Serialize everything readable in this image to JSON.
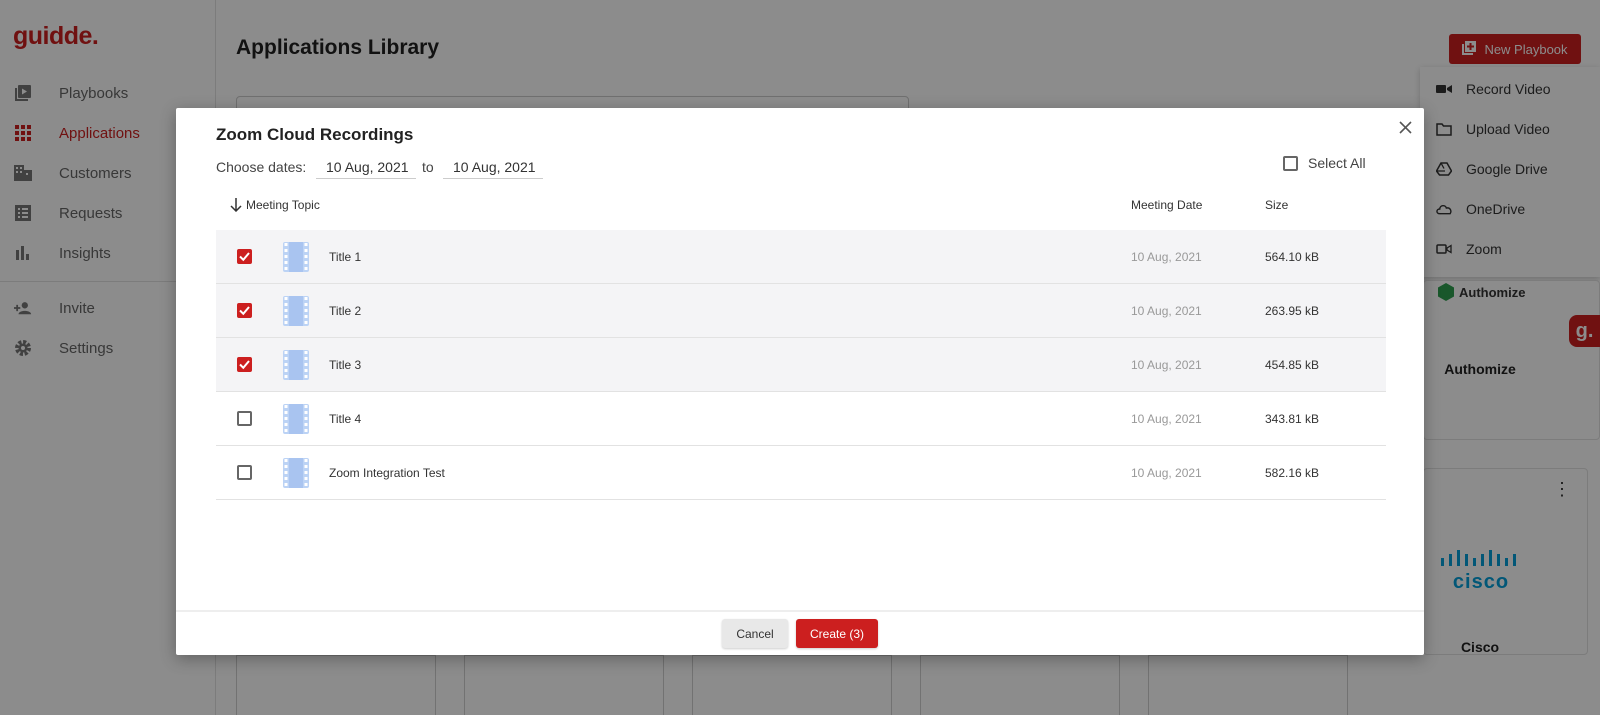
{
  "app": {
    "logo": "guidde.",
    "brand_color": "#cc1f1f"
  },
  "sidebar": {
    "items": [
      {
        "label": "Playbooks",
        "icon": "playbooks-icon"
      },
      {
        "label": "Applications",
        "icon": "apps-grid-icon"
      },
      {
        "label": "Customers",
        "icon": "building-icon"
      },
      {
        "label": "Requests",
        "icon": "list-icon"
      },
      {
        "label": "Insights",
        "icon": "bar-chart-icon"
      },
      {
        "label": "Invite",
        "icon": "add-user-icon"
      },
      {
        "label": "Settings",
        "icon": "gear-icon"
      }
    ]
  },
  "header": {
    "title": "Applications Library",
    "new_playbook_label": "New Playbook"
  },
  "new_menu": {
    "items": [
      {
        "label": "Record Video",
        "icon": "video-camera-icon"
      },
      {
        "label": "Upload Video",
        "icon": "folder-icon"
      },
      {
        "label": "Google Drive",
        "icon": "google-drive-icon"
      },
      {
        "label": "OneDrive",
        "icon": "onedrive-icon"
      },
      {
        "label": "Zoom",
        "icon": "zoom-icon"
      }
    ]
  },
  "cards": {
    "authomize_logo": "Authomize",
    "authomize_name": "Authomize",
    "cisco_logo": "cisco",
    "cisco_name": "Cisco"
  },
  "floater": "g.",
  "modal": {
    "title": "Zoom Cloud Recordings",
    "dates_label": "Choose dates:",
    "from_date": "10 Aug, 2021",
    "to_label": "to",
    "to_date": "10 Aug, 2021",
    "select_all_label": "Select All",
    "columns": {
      "topic": "Meeting Topic",
      "date": "Meeting Date",
      "size": "Size"
    },
    "rows": [
      {
        "topic": "Title 1",
        "date": "10 Aug, 2021",
        "size": "564.10 kB",
        "checked": true
      },
      {
        "topic": "Title 2",
        "date": "10 Aug, 2021",
        "size": "263.95 kB",
        "checked": true
      },
      {
        "topic": "Title 3",
        "date": "10 Aug, 2021",
        "size": "454.85 kB",
        "checked": true
      },
      {
        "topic": "Title 4",
        "date": "10 Aug, 2021",
        "size": "343.81 kB",
        "checked": false
      },
      {
        "topic": "Zoom Integration Test",
        "date": "10 Aug, 2021",
        "size": "582.16 kB",
        "checked": false
      }
    ],
    "cancel_label": "Cancel",
    "create_label": "Create (3)"
  }
}
